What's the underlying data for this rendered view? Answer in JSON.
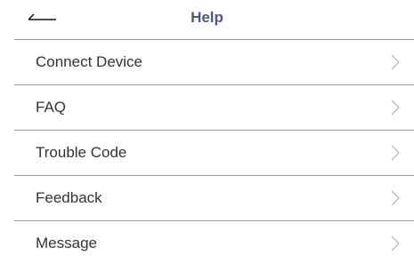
{
  "header": {
    "title": "Help",
    "back_icon": "arrow-left-icon"
  },
  "menu": {
    "items": [
      {
        "label": "Connect Device",
        "icon": "chevron-right-icon"
      },
      {
        "label": "FAQ",
        "icon": "chevron-right-icon"
      },
      {
        "label": "Trouble Code",
        "icon": "chevron-right-icon"
      },
      {
        "label": "Feedback",
        "icon": "chevron-right-icon"
      },
      {
        "label": "Message",
        "icon": "chevron-right-icon"
      }
    ]
  },
  "colors": {
    "title": "#4a5a85",
    "text": "#333333",
    "divider": "#999999",
    "chevron": "#bbbbbb"
  }
}
